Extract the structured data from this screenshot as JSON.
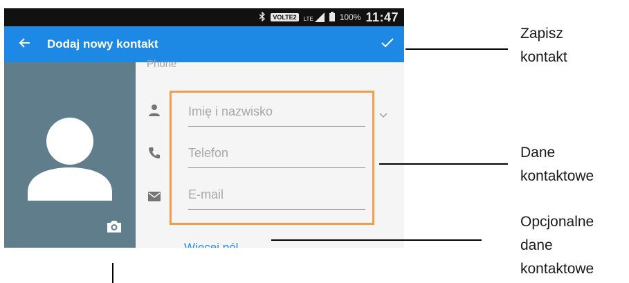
{
  "status_bar": {
    "network_badge": "VOLTE2",
    "signal_label": "LTE",
    "battery": "100%",
    "time": "11:47"
  },
  "app_bar": {
    "title": "Dodaj nowy kontakt"
  },
  "form": {
    "section_label": "Phone",
    "name_placeholder": "Imię i nazwisko",
    "phone_placeholder": "Telefon",
    "email_placeholder": "E-mail",
    "more_fields_label": "Więcej pól"
  },
  "annotations": {
    "save_line1": "Zapisz",
    "save_line2": "kontakt",
    "contact_line1": "Dane",
    "contact_line2": "kontaktowe",
    "optional_line1": "Opcjonalne",
    "optional_line2": "dane",
    "optional_line3": "kontaktowe"
  },
  "colors": {
    "app_bar": "#1e88e5",
    "photo_panel": "#607d8b",
    "highlight": "#f39c4a",
    "link": "#1e88e5"
  },
  "icons": [
    "arrow-back-icon",
    "check-icon",
    "person-icon",
    "phone-icon",
    "email-icon",
    "camera-icon",
    "chevron-down-icon",
    "bluetooth-icon",
    "signal-icon",
    "battery-icon"
  ]
}
